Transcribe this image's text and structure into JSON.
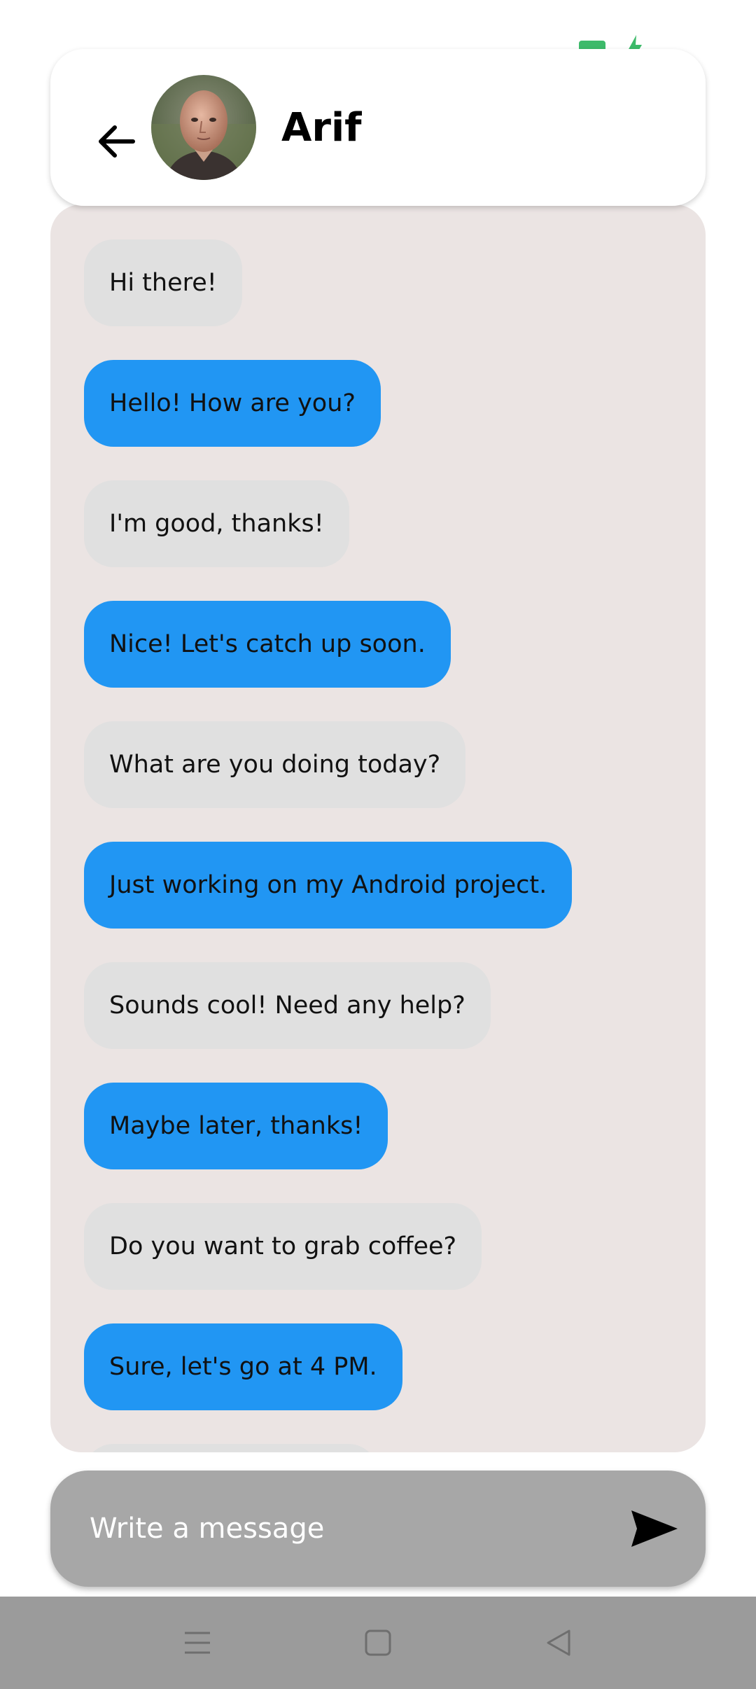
{
  "colors": {
    "status_green": "#3DBA6A",
    "chat_bg": "#EBE4E3",
    "incoming_bubble": "#E0E0E0",
    "outgoing_bubble": "#2196F3",
    "composer_bg": "#A7A7A7",
    "navbar_bg": "#9B9B9B",
    "nav_icon": "#6E6E6E"
  },
  "status_bar": {
    "icons": [
      "battery-icon",
      "charging-bolt-icon"
    ]
  },
  "header": {
    "back_icon": "arrow-left-icon",
    "avatar": "avatar-photo",
    "contact_name": "Arif"
  },
  "messages": [
    {
      "text": "Hi there!",
      "direction": "incoming"
    },
    {
      "text": "Hello! How are you?",
      "direction": "outgoing"
    },
    {
      "text": "I'm good, thanks!",
      "direction": "incoming"
    },
    {
      "text": "Nice! Let's catch up soon.",
      "direction": "outgoing"
    },
    {
      "text": "What are you doing today?",
      "direction": "incoming"
    },
    {
      "text": "Just working on my Android project.",
      "direction": "outgoing"
    },
    {
      "text": "Sounds cool! Need any help?",
      "direction": "incoming"
    },
    {
      "text": "Maybe later, thanks!",
      "direction": "outgoing"
    },
    {
      "text": "Do you want to grab coffee?",
      "direction": "incoming"
    },
    {
      "text": "Sure, let's go at 4 PM.",
      "direction": "outgoing"
    },
    {
      "text": "",
      "direction": "incoming"
    }
  ],
  "composer": {
    "placeholder": "Write a message",
    "value": "",
    "send_icon": "send-icon"
  },
  "nav_bar": {
    "icons": [
      "menu-icon",
      "home-square-icon",
      "back-triangle-icon"
    ]
  }
}
